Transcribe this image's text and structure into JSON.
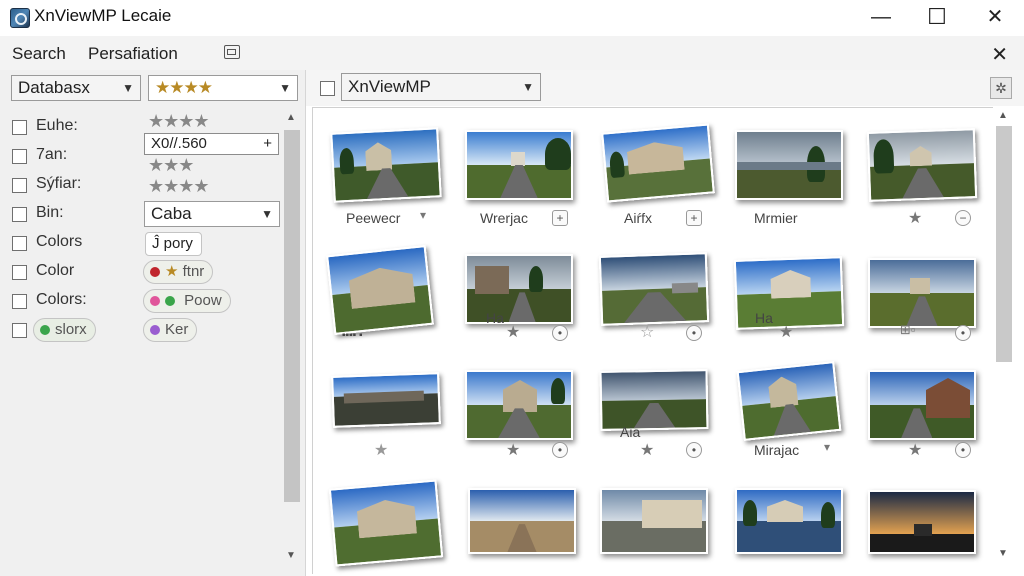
{
  "window": {
    "title": "XnViewMP Lecaie",
    "min_glyph": "—",
    "max_glyph": "☐",
    "close_glyph": "✕"
  },
  "menu": {
    "search": "Search",
    "persaf": "Persafiation",
    "panel_close": "✕"
  },
  "filters": {
    "database": "Databasx",
    "rating_stars": "★★★★",
    "right_dropdown": "XnViewMP",
    "rows": [
      {
        "label": "Euhe:"
      },
      {
        "label": "7an:"
      },
      {
        "label": "Sýfiar:"
      },
      {
        "label": "Bin:"
      },
      {
        "label": "Colors"
      },
      {
        "label": "Color"
      },
      {
        "label": "Colors:"
      }
    ],
    "last_row_pill": "slorx",
    "star_row1": "★★★★",
    "input_value": "X0//.560",
    "input_plus": "+",
    "star_row3": "★★★",
    "star_row4": "★★★★",
    "caba": "Caba",
    "jpory": "Ĵ pory",
    "pill_ftnr": "ftnr",
    "pill_poow": "Poow",
    "pill_ker": "Ker"
  },
  "grid": {
    "labels": {
      "r1c1": "Peewecr",
      "r1c2": "Wrerjac",
      "r1c3": "Aiŕfx",
      "r1c4": "Mrmier",
      "r2c2": "Ha",
      "r2c4": "Ha",
      "r3c3": "Aia",
      "r3c4": "Mirajac"
    }
  },
  "colors": {
    "accent_star": "#b88a25",
    "dot_red": "#c0262d",
    "dot_pink": "#e0569a",
    "dot_green": "#3aa54a",
    "dot_purple": "#9a5ed0"
  }
}
